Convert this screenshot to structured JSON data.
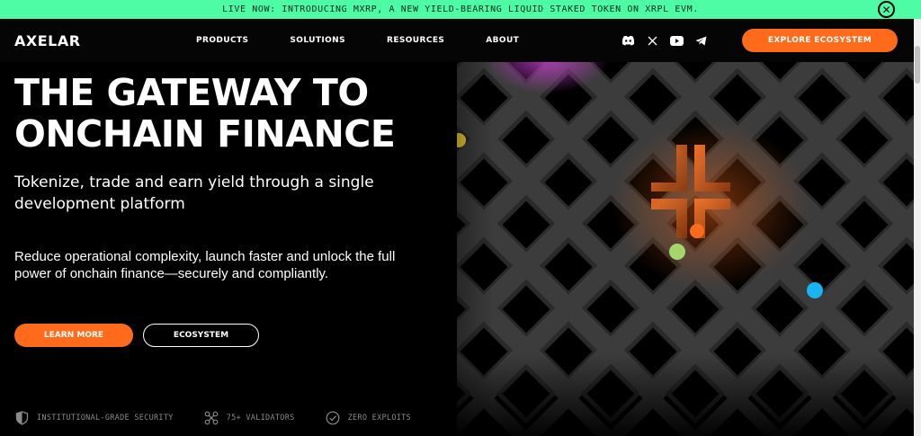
{
  "banner": {
    "text": "LIVE NOW: INTRODUCING MXRP, A NEW YIELD-BEARING LIQUID STAKED TOKEN ON XRPL EVM.",
    "close_glyph": "✕"
  },
  "nav": {
    "logo": "AXELAR",
    "links": [
      "PRODUCTS",
      "SOLUTIONS",
      "RESOURCES",
      "ABOUT"
    ],
    "socials": [
      "discord-icon",
      "x-icon",
      "youtube-icon",
      "telegram-icon"
    ],
    "cta": "EXPLORE ECOSYSTEM"
  },
  "hero": {
    "title_line1": "THE GATEWAY TO",
    "title_line2": "ONCHAIN FINANCE",
    "subtitle": "Tokenize, trade and earn yield through a single development platform",
    "body": "Reduce operational complexity, launch faster and unlock the full power of onchain finance—securely and compliantly.",
    "primary_button": "LEARN MORE",
    "secondary_button": "ECOSYSTEM"
  },
  "badges": [
    {
      "icon": "shield-icon",
      "label": "INSTITUTIONAL-GRADE SECURITY"
    },
    {
      "icon": "validators-icon",
      "label": "75+ VALIDATORS"
    },
    {
      "icon": "check-circle-icon",
      "label": "ZERO EXPLOITS"
    }
  ],
  "colors": {
    "accent": "#ff6b1a",
    "banner": "#4dfca5",
    "background": "#000000",
    "dot_yellow": "#f2d43a",
    "dot_green": "#a5d66a",
    "dot_blue": "#19b4f2",
    "dot_orange": "#ff6a1a",
    "glow_pink": "#c03cc8"
  }
}
